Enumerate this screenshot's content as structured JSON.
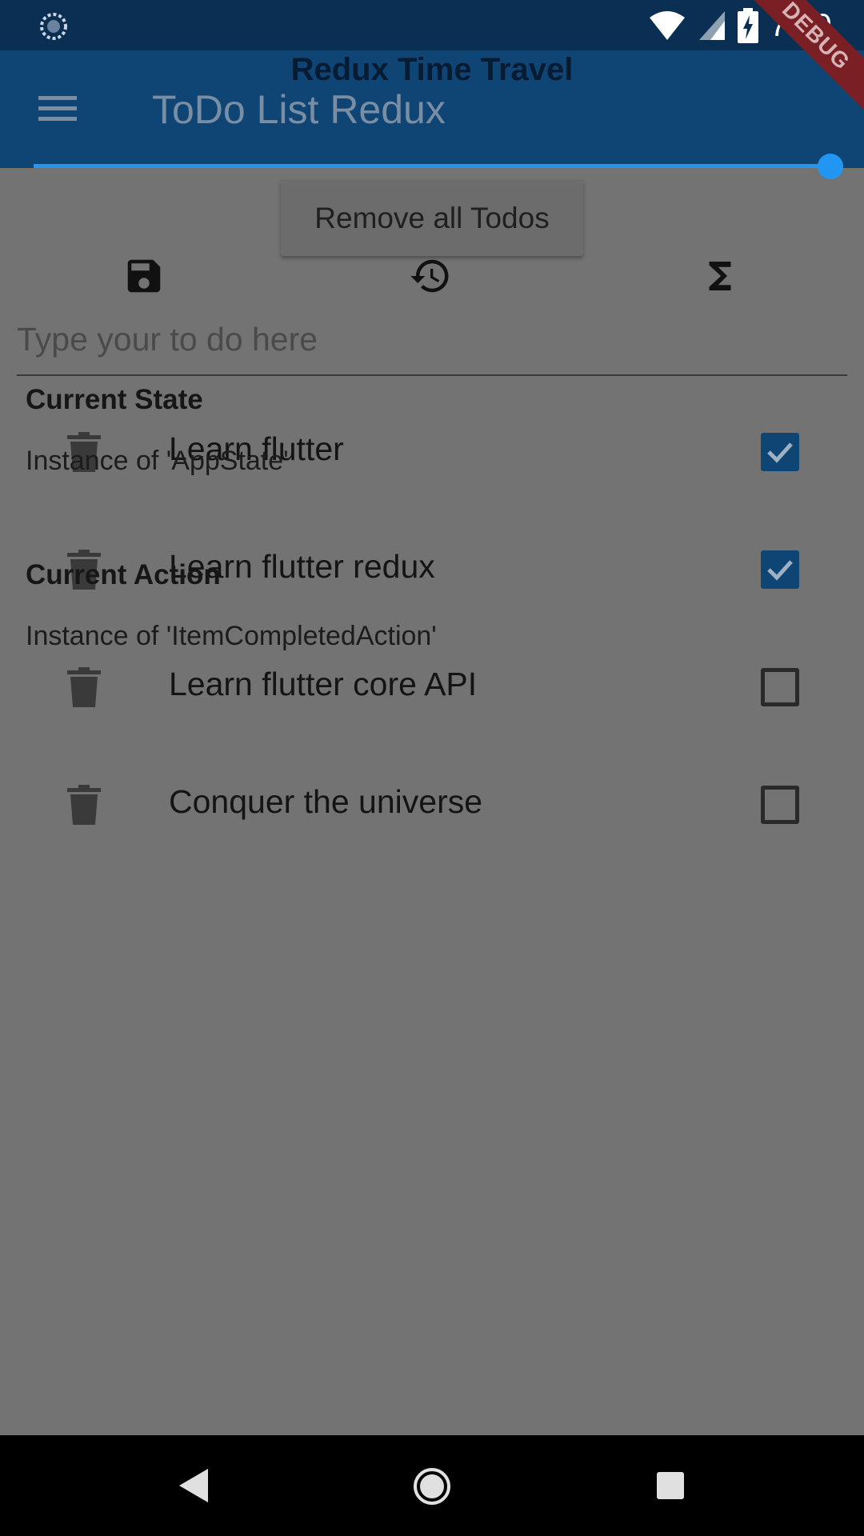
{
  "status_bar": {
    "time": "7:49",
    "left_icon": "sync-icon",
    "icons": [
      "wifi-icon",
      "signal-icon",
      "battery-charging-icon"
    ]
  },
  "debug_banner": "DEBUG",
  "app_bar": {
    "overlay_title": "Redux Time Travel",
    "title": "ToDo List Redux",
    "menu_icon": "menu-icon"
  },
  "time_travel": {
    "slider_position_fraction": 1.0,
    "remove_all_label": "Remove all Todos",
    "current_state_heading": "Current State",
    "current_state_value": "Instance of 'AppState'",
    "current_action_heading": "Current Action",
    "current_action_value": "Instance of 'ItemCompletedAction'"
  },
  "toolbar": {
    "icons": [
      "save-icon",
      "history-icon",
      "sigma-icon"
    ]
  },
  "input": {
    "placeholder": "Type your to do here",
    "value": ""
  },
  "todos": [
    {
      "label": "Learn flutter",
      "completed": true
    },
    {
      "label": "Learn flutter redux",
      "completed": true
    },
    {
      "label": "Learn flutter core API",
      "completed": false
    },
    {
      "label": "Conquer the universe",
      "completed": false
    }
  ],
  "colors": {
    "app_bar": "#0f4575",
    "status_bar": "#0b2f52",
    "accent": "#2196f3",
    "scrim_background": "#737373"
  },
  "nav_bar": {
    "icons": [
      "back-icon",
      "home-icon",
      "recent-apps-icon"
    ]
  }
}
